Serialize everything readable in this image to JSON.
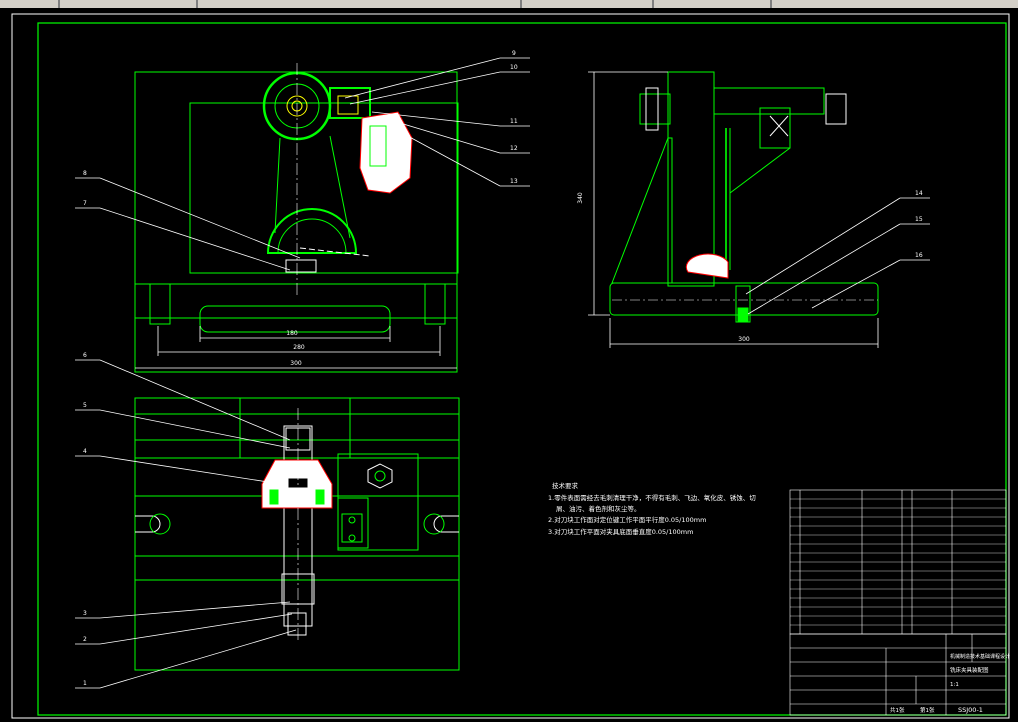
{
  "leaders": {
    "n1": "1",
    "n2": "2",
    "n3": "3",
    "n4": "4",
    "n5": "5",
    "n6": "6",
    "n7": "7",
    "n8": "8",
    "n9": "9",
    "n10": "10",
    "n11": "11",
    "n12": "12",
    "n13": "13",
    "n14": "14",
    "n15": "15",
    "n16": "16"
  },
  "dims": {
    "front_inner": "180",
    "front_mid": "280",
    "front_outer": "300",
    "side_bottom": "300",
    "side_height": "340"
  },
  "notes": {
    "title": "技术要求",
    "line1": "1.零件表面需经去毛刺清理干净，不得有毛刺、飞边、氧化皮、锈蚀、切",
    "line1b": "屑、油污、着色剂和灰尘等。",
    "line2": "2.对刀块工作面对定位键工作平面平行度0.05/100mm",
    "line3": "3.对刀块工作平面对夹具底面垂直度0.05/100mm"
  },
  "title_block": {
    "school": "机械制造技术基础课程设计",
    "drawing_name": "铣床夹具装配图",
    "drawing_no": "SSJ00-1",
    "scale": "1:1",
    "sheets": "共1张",
    "sheet": "第1张"
  },
  "colors": {
    "frame": "#00ff00",
    "part": "#00ff00",
    "white": "#ffffff",
    "red": "#ff0000",
    "yellow": "#ffff00",
    "cyan": "#00ffff"
  }
}
